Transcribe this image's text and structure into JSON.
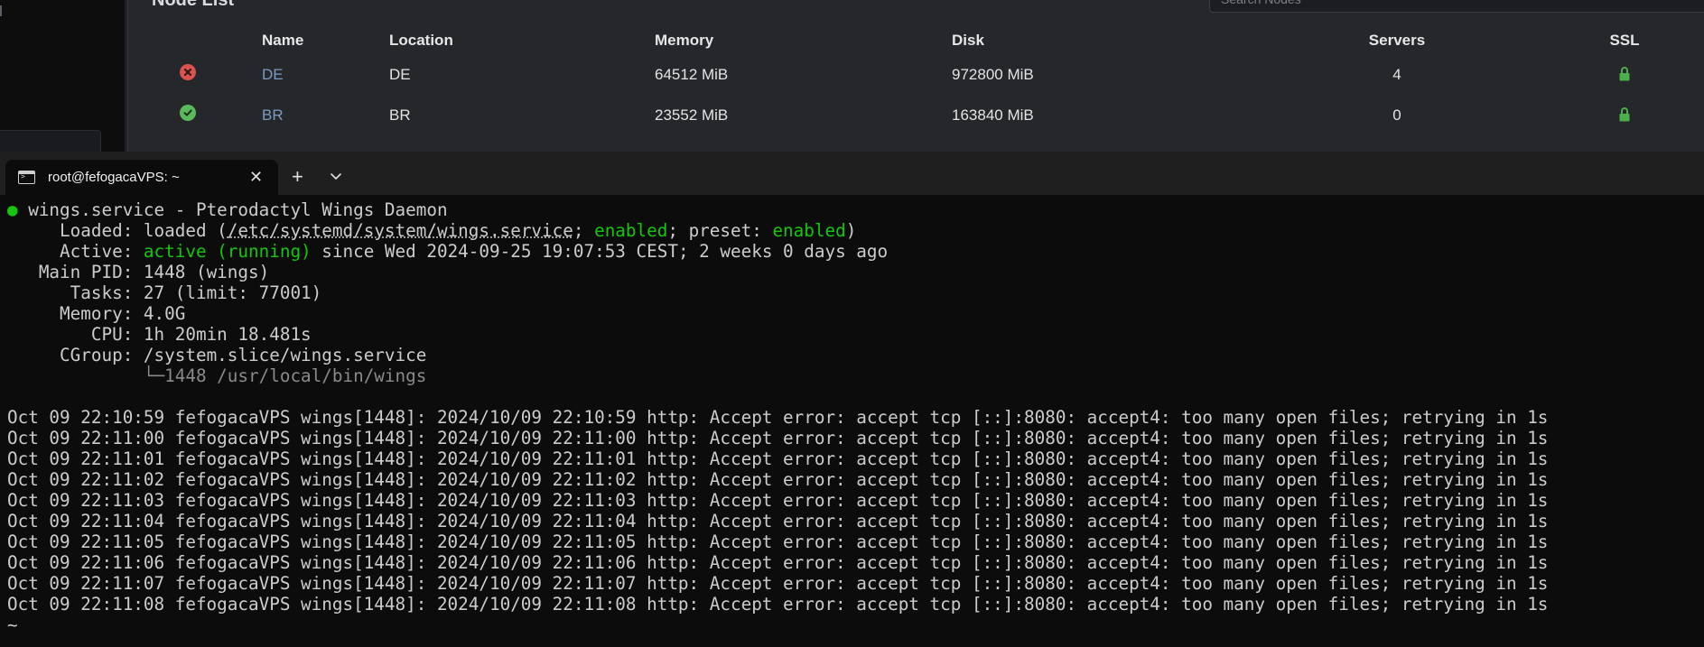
{
  "web": {
    "panel_title": "Node List",
    "search_placeholder": "Search Nodes",
    "columns": {
      "name": "Name",
      "location": "Location",
      "memory": "Memory",
      "disk": "Disk",
      "servers": "Servers",
      "ssl": "SSL"
    },
    "nodes": [
      {
        "status": "offline",
        "name": "DE",
        "location": "DE",
        "memory": "64512 MiB",
        "disk": "972800 MiB",
        "servers": "4",
        "ssl": "lock-icon"
      },
      {
        "status": "online",
        "name": "BR",
        "location": "BR",
        "memory": "23552 MiB",
        "disk": "163840 MiB",
        "servers": "0",
        "ssl": "lock-icon"
      }
    ]
  },
  "terminal": {
    "tab_title": "root@fefogacaVPS: ~",
    "close_label": "✕",
    "new_tab_label": "+",
    "service": {
      "unit": "wings.service",
      "description": "Pterodactyl Wings Daemon",
      "loaded_label": "Loaded:",
      "loaded_value": "loaded",
      "loaded_path": "/etc/systemd/system/wings.service",
      "enabled": "enabled",
      "preset_label": "preset:",
      "preset_value": "enabled",
      "active_label": "Active:",
      "active_state": "active (running)",
      "active_since": "since Wed 2024-09-25 19:07:53 CEST; 2 weeks 0 days ago",
      "main_pid_label": "Main PID:",
      "main_pid": "1448 (wings)",
      "tasks_label": "Tasks:",
      "tasks": "27 (limit: 77001)",
      "memory_label": "Memory:",
      "memory": "4.0G",
      "cpu_label": "CPU:",
      "cpu": "1h 20min 18.481s",
      "cgroup_label": "CGroup:",
      "cgroup": "/system.slice/wings.service",
      "cgroup_child": "└─1448 /usr/local/bin/wings"
    },
    "log_lines": [
      "Oct 09 22:10:59 fefogacaVPS wings[1448]: 2024/10/09 22:10:59 http: Accept error: accept tcp [::]:8080: accept4: too many open files; retrying in 1s",
      "Oct 09 22:11:00 fefogacaVPS wings[1448]: 2024/10/09 22:11:00 http: Accept error: accept tcp [::]:8080: accept4: too many open files; retrying in 1s",
      "Oct 09 22:11:01 fefogacaVPS wings[1448]: 2024/10/09 22:11:01 http: Accept error: accept tcp [::]:8080: accept4: too many open files; retrying in 1s",
      "Oct 09 22:11:02 fefogacaVPS wings[1448]: 2024/10/09 22:11:02 http: Accept error: accept tcp [::]:8080: accept4: too many open files; retrying in 1s",
      "Oct 09 22:11:03 fefogacaVPS wings[1448]: 2024/10/09 22:11:03 http: Accept error: accept tcp [::]:8080: accept4: too many open files; retrying in 1s",
      "Oct 09 22:11:04 fefogacaVPS wings[1448]: 2024/10/09 22:11:04 http: Accept error: accept tcp [::]:8080: accept4: too many open files; retrying in 1s",
      "Oct 09 22:11:05 fefogacaVPS wings[1448]: 2024/10/09 22:11:05 http: Accept error: accept tcp [::]:8080: accept4: too many open files; retrying in 1s",
      "Oct 09 22:11:06 fefogacaVPS wings[1448]: 2024/10/09 22:11:06 http: Accept error: accept tcp [::]:8080: accept4: too many open files; retrying in 1s",
      "Oct 09 22:11:07 fefogacaVPS wings[1448]: 2024/10/09 22:11:07 http: Accept error: accept tcp [::]:8080: accept4: too many open files; retrying in 1s",
      "Oct 09 22:11:08 fefogacaVPS wings[1448]: 2024/10/09 22:11:08 http: Accept error: accept tcp [::]:8080: accept4: too many open files; retrying in 1s"
    ],
    "prompt": "~"
  }
}
